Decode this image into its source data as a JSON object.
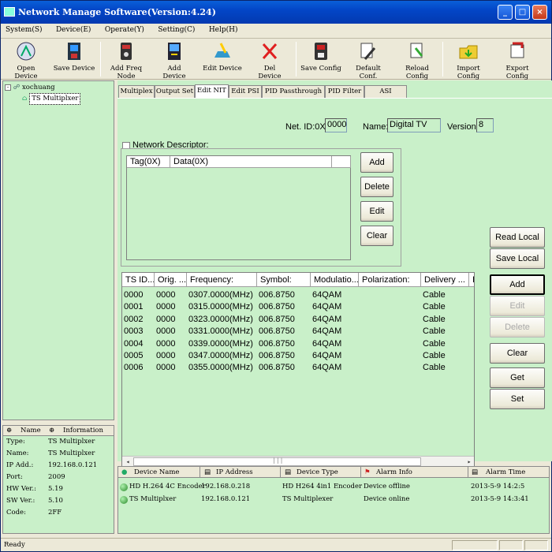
{
  "window": {
    "title": "Network Manage Software(Version:4.24)",
    "minimize": "_",
    "maximize": "□",
    "close": "×"
  },
  "menu": [
    "System(S)",
    "Device(E)",
    "Operate(Y)",
    "Setting(C)",
    "Help(H)"
  ],
  "toolbar": [
    {
      "label": "Open Device",
      "icon": "open-device-icon"
    },
    {
      "label": "Save Device",
      "icon": "save-device-icon"
    },
    {
      "label": "Add Freq Node",
      "icon": "add-freq-node-icon"
    },
    {
      "label": "Add Device",
      "icon": "add-device-icon"
    },
    {
      "label": "Edit Device",
      "icon": "edit-device-icon"
    },
    {
      "label": "Del Device",
      "icon": "delete-icon"
    },
    {
      "label": "Save Config",
      "icon": "save-config-icon"
    },
    {
      "label": "Default Conf.",
      "icon": "default-config-icon"
    },
    {
      "label": "Reload Config",
      "icon": "reload-config-icon"
    },
    {
      "label": "Import Config",
      "icon": "import-config-icon"
    },
    {
      "label": "Export Config",
      "icon": "export-config-icon"
    }
  ],
  "tree": {
    "root": "xochuang",
    "child": "TS Multiplxer"
  },
  "info": {
    "headers": [
      "Name",
      "Information"
    ],
    "rows": [
      {
        "key": "Type:",
        "value": "TS Multiplxer"
      },
      {
        "key": "Name:",
        "value": "TS Multiplxer"
      },
      {
        "key": "IP Add.:",
        "value": "192.168.0.121"
      },
      {
        "key": "Port:",
        "value": "2009"
      },
      {
        "key": "HW Ver.:",
        "value": "5.19"
      },
      {
        "key": "SW Ver.:",
        "value": "5.10"
      },
      {
        "key": "Code:",
        "value": "2FF"
      }
    ]
  },
  "tabs": [
    "Multiplex",
    "Output Set",
    "Edit NIT",
    "Edit PSI",
    "PID Passthrough",
    "PID Filter",
    "ASI Monitor"
  ],
  "nit": {
    "net_id_label": "Net. ID:0X",
    "net_id_value": "0000",
    "name_label": "Name:",
    "name_value": "Digital TV",
    "version_label": "Version",
    "version_value": "8",
    "descriptor_label": "Network Descriptor:",
    "desc_cols": [
      "Tag(0X)",
      "Data(0X)"
    ],
    "desc_buttons": [
      "Add",
      "Delete",
      "Edit",
      "Clear"
    ]
  },
  "ts": {
    "cols": [
      "TS ID...",
      "Orig. ...",
      "Frequency:",
      "Symbol:",
      "Modulatio...",
      "Polarization:",
      "Delivery ...",
      "I"
    ],
    "rows": [
      [
        "0000",
        "0000",
        "0307.0000(MHz)",
        "006.8750",
        "64QAM",
        "",
        "Cable"
      ],
      [
        "0001",
        "0000",
        "0315.0000(MHz)",
        "006.8750",
        "64QAM",
        "",
        "Cable"
      ],
      [
        "0002",
        "0000",
        "0323.0000(MHz)",
        "006.8750",
        "64QAM",
        "",
        "Cable"
      ],
      [
        "0003",
        "0000",
        "0331.0000(MHz)",
        "006.8750",
        "64QAM",
        "",
        "Cable"
      ],
      [
        "0004",
        "0000",
        "0339.0000(MHz)",
        "006.8750",
        "64QAM",
        "",
        "Cable"
      ],
      [
        "0005",
        "0000",
        "0347.0000(MHz)",
        "006.8750",
        "64QAM",
        "",
        "Cable"
      ],
      [
        "0006",
        "0000",
        "0355.0000(MHz)",
        "006.8750",
        "64QAM",
        "",
        "Cable"
      ]
    ],
    "scroll_left": "◂",
    "scroll_right": "▸",
    "scroll_grip": "|||"
  },
  "side_buttons": {
    "read_local": "Read Local",
    "save_local": "Save Local",
    "add": "Add",
    "edit": "Edit",
    "delete": "Delete",
    "clear": "Clear",
    "get": "Get",
    "set": "Set"
  },
  "devices": {
    "cols": [
      "Device Name",
      "IP Address",
      "Device Type",
      "Alarm Info",
      "Alarm Time"
    ],
    "rows": [
      [
        "HD H.264 4C Encoder",
        "192.168.0.218",
        "HD H264 4in1 Encoder",
        "Device offline",
        "2013-5-9 14:2:5"
      ],
      [
        "TS Multiplxer",
        "192.168.0.121",
        "TS Multiplexer",
        "Device online",
        "2013-5-9 14:3:41"
      ]
    ]
  },
  "status": "Ready"
}
